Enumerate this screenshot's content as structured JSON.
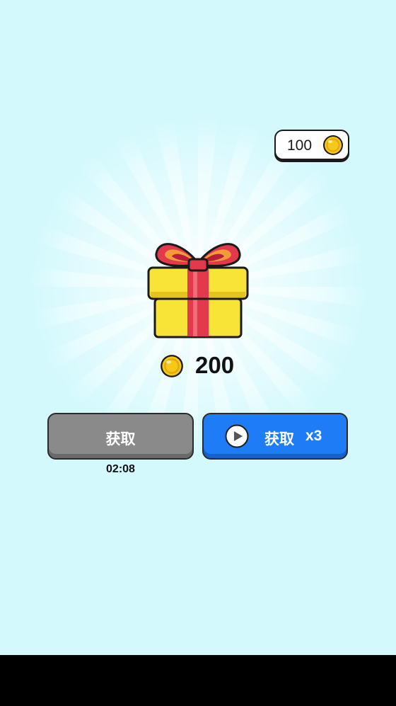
{
  "balance": {
    "value": "100",
    "icon": "coin-icon"
  },
  "reward": {
    "icon": "coin-icon",
    "amount": "200"
  },
  "gift": {
    "icon": "gift-box-icon"
  },
  "buttons": {
    "get_label": "获取",
    "timer": "02:08",
    "ad_label": "获取",
    "ad_multiplier": "x3",
    "ad_icon": "play-icon"
  },
  "colors": {
    "background": "#d3f9fd",
    "coin": "#f7c71a",
    "gift_box": "#f7e437",
    "ribbon": "#e23a4c",
    "button_get": "#8a8a8a",
    "button_ad": "#1f7cf7"
  }
}
